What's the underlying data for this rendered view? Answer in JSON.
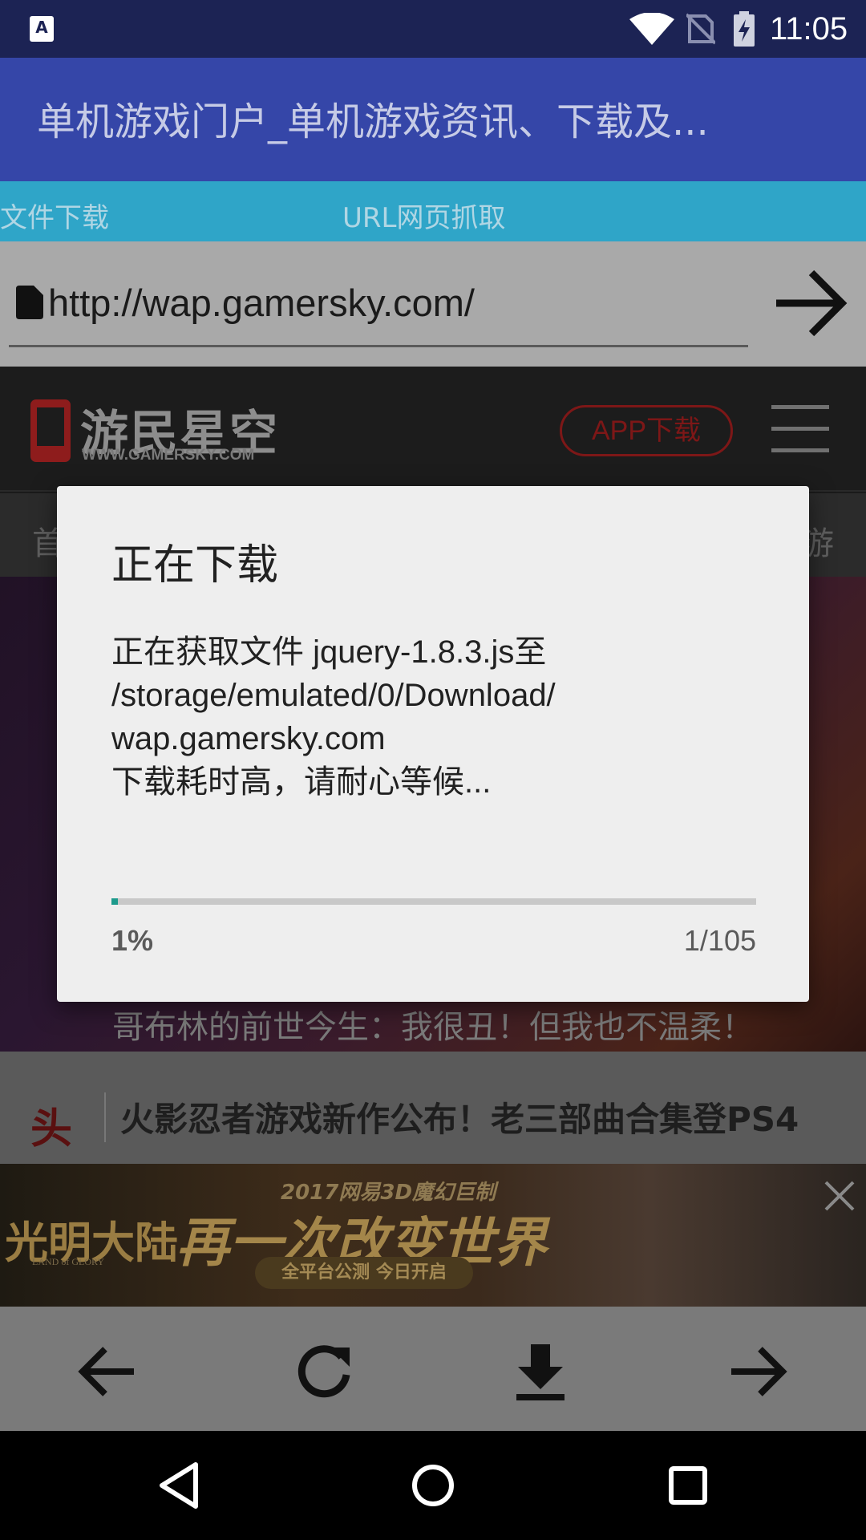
{
  "status_bar": {
    "app_icon_letter": "A",
    "time": "11:05",
    "icons": [
      "wifi-icon",
      "no-sim-icon",
      "battery-charging-icon"
    ]
  },
  "app_bar": {
    "title": "单机游戏门户_单机游戏资讯、下载及..."
  },
  "tabs": [
    {
      "label": "文件下载"
    },
    {
      "label": "URL网页抓取"
    }
  ],
  "url_bar": {
    "value": "http://wap.gamersky.com/",
    "go_icon": "arrow-right-icon"
  },
  "web": {
    "logo_text": "游民星空",
    "logo_sub": "WWW.GAMERSKY.COM",
    "app_download_label": "APP下载",
    "nav_left": "首",
    "nav_right": "游",
    "banner_caption": "哥布林的前世今生：我很丑！但我也不温柔！",
    "news_tag": "头",
    "news_title": "火影忍者游戏新作公布！老三部曲合集登PS4",
    "ad": {
      "subtitle": "2017网易3D魔幻巨制",
      "brand": "光明大陆",
      "brand_sub": "LAND of GLORY",
      "slogan": "再一次改变世界",
      "pill": "全平台公测  今日开启"
    }
  },
  "dialog": {
    "title": "正在下载",
    "message_lines": [
      "正在获取文件 jquery-1.8.3.js至",
      "/storage/emulated/0/Download/",
      "wap.gamersky.com",
      "下载耗时高，请耐心等候..."
    ],
    "progress": 0.01,
    "percent_label": "1%",
    "count_label": "1/105",
    "progress_color": "#1d9a8c"
  },
  "toolbar": {
    "buttons": [
      "back-arrow-icon",
      "refresh-icon",
      "download-icon",
      "forward-arrow-icon"
    ]
  },
  "system_nav": {
    "buttons": [
      "back-triangle-icon",
      "home-circle-icon",
      "recents-square-icon"
    ]
  },
  "colors": {
    "status_bar": "#1c2354",
    "app_bar": "#3546a8",
    "tab_bar": "#2fa5c8",
    "accent": "#1d9a8c"
  }
}
